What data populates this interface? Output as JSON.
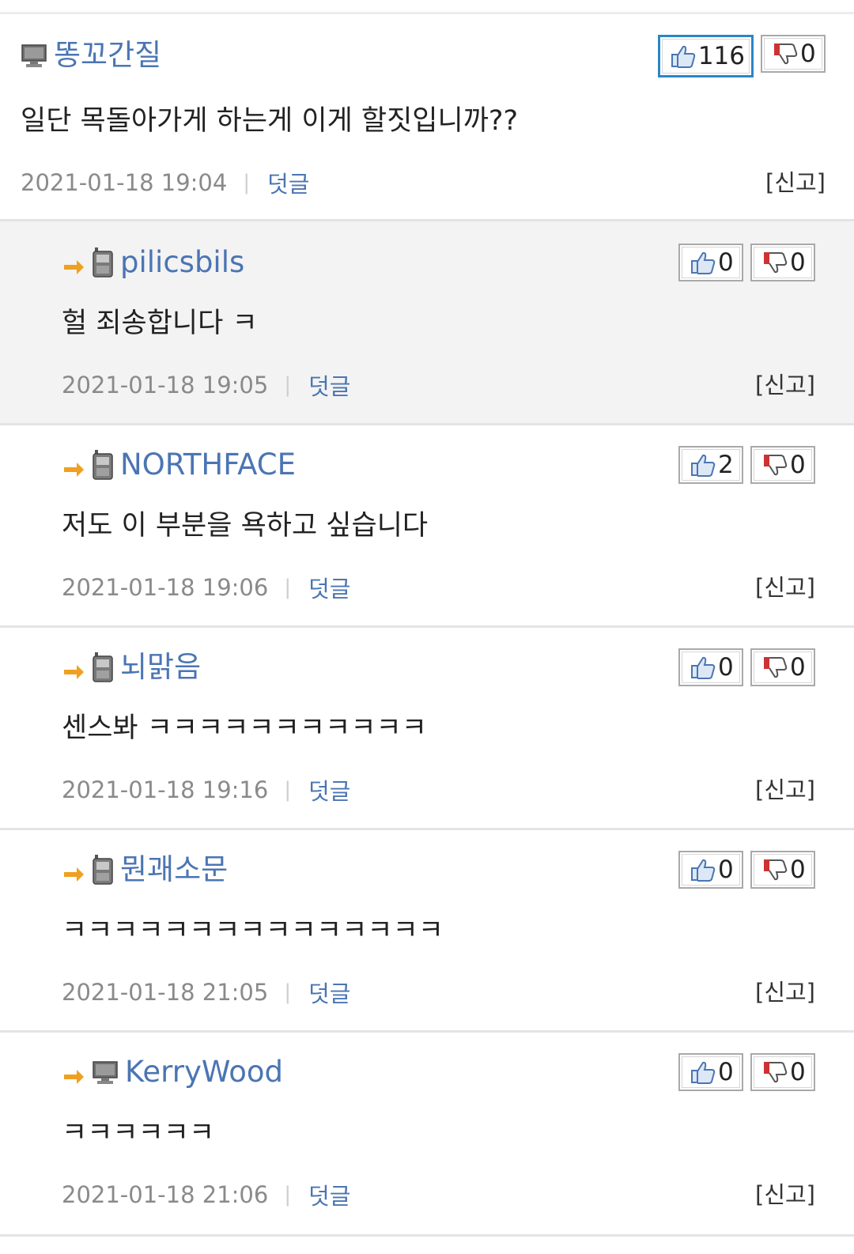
{
  "comments": [
    {
      "author": "똥꼬간질",
      "device": "pc",
      "reply": false,
      "text": "일단 목돌아가게 하는게 이게 할짓입니까??",
      "date": "2021-01-18 19:04",
      "reply_label": "덧글",
      "report_label": "[신고]",
      "up": "116",
      "down": "0",
      "up_highlight": true
    },
    {
      "author": "pilicsbils",
      "device": "mobile",
      "reply": true,
      "text": "헐 죄송합니다 ㅋ",
      "date": "2021-01-18 19:05",
      "reply_label": "덧글",
      "report_label": "[신고]",
      "up": "0",
      "down": "0"
    },
    {
      "author": "NORTHFACE",
      "device": "mobile",
      "reply": true,
      "text": "저도 이 부분을 욕하고 싶습니다",
      "date": "2021-01-18 19:06",
      "reply_label": "덧글",
      "report_label": "[신고]",
      "up": "2",
      "down": "0"
    },
    {
      "author": "뇌맑음",
      "device": "mobile",
      "reply": true,
      "text": "센스봐 ㅋㅋㅋㅋㅋㅋㅋㅋㅋㅋㅋ",
      "date": "2021-01-18 19:16",
      "reply_label": "덧글",
      "report_label": "[신고]",
      "up": "0",
      "down": "0"
    },
    {
      "author": "뭔괘소문",
      "device": "mobile",
      "reply": true,
      "text": "ㅋㅋㅋㅋㅋㅋㅋㅋㅋㅋㅋㅋㅋㅋㅋ",
      "date": "2021-01-18 21:05",
      "reply_label": "덧글",
      "report_label": "[신고]",
      "up": "0",
      "down": "0"
    },
    {
      "author": "KerryWood",
      "device": "pc",
      "reply": true,
      "text": "ㅋㅋㅋㅋㅋㅋ",
      "date": "2021-01-18 21:06",
      "reply_label": "덧글",
      "report_label": "[신고]",
      "up": "0",
      "down": "0"
    }
  ],
  "colors": {
    "author": "#4b75b3",
    "arrow": "#f0a020",
    "highlight_border": "#2a86c8",
    "thumb_up": "#4b75b3",
    "thumb_down": "#cc3333"
  },
  "icons": {
    "reply_arrow": "reply-arrow-icon",
    "pc": "monitor-icon",
    "mobile": "mobile-phone-icon",
    "up": "thumbs-up-icon",
    "down": "thumbs-down-icon"
  }
}
